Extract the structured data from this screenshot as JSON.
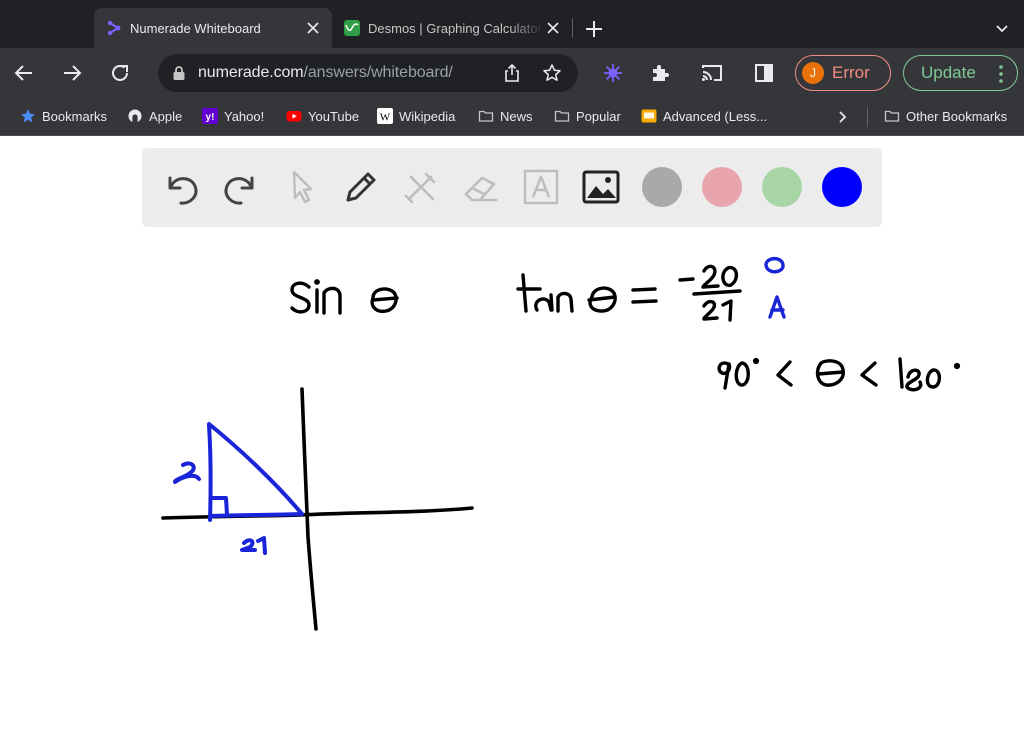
{
  "tabs": [
    {
      "title": "Numerade Whiteboard",
      "active": true,
      "favicon": "numerade-logo-icon"
    },
    {
      "title": "Desmos | Graphing Calculator",
      "active": false,
      "favicon": "desmos-logo-icon"
    }
  ],
  "omnibox": {
    "url_host": "numerade.com",
    "url_path": "/answers/whiteboard/"
  },
  "profile": {
    "initial": "J",
    "status": "Error"
  },
  "update_label": "Update",
  "bookmarks": {
    "items": [
      {
        "label": "Bookmarks",
        "icon": "star-icon"
      },
      {
        "label": "Apple",
        "icon": "apple-icon"
      },
      {
        "label": "Yahoo!",
        "icon": "yahoo-icon"
      },
      {
        "label": "YouTube",
        "icon": "youtube-icon"
      },
      {
        "label": "Wikipedia",
        "icon": "wikipedia-icon"
      },
      {
        "label": "News",
        "icon": "folder-icon"
      },
      {
        "label": "Popular",
        "icon": "folder-icon"
      },
      {
        "label": "Advanced (Less...",
        "icon": "bookmark-page-icon"
      }
    ],
    "other": "Other Bookmarks"
  },
  "whiteboard": {
    "tools": [
      "undo-icon",
      "redo-icon",
      "pointer-icon",
      "pen-icon",
      "tools-icon",
      "eraser-icon",
      "text-icon",
      "image-icon"
    ],
    "colors": [
      "#a9a9a9",
      "#e8a5ad",
      "#a8d5a6",
      "#0000ff"
    ],
    "ink_colors": {
      "black": "#000000",
      "blue": "#1a24d8"
    }
  }
}
